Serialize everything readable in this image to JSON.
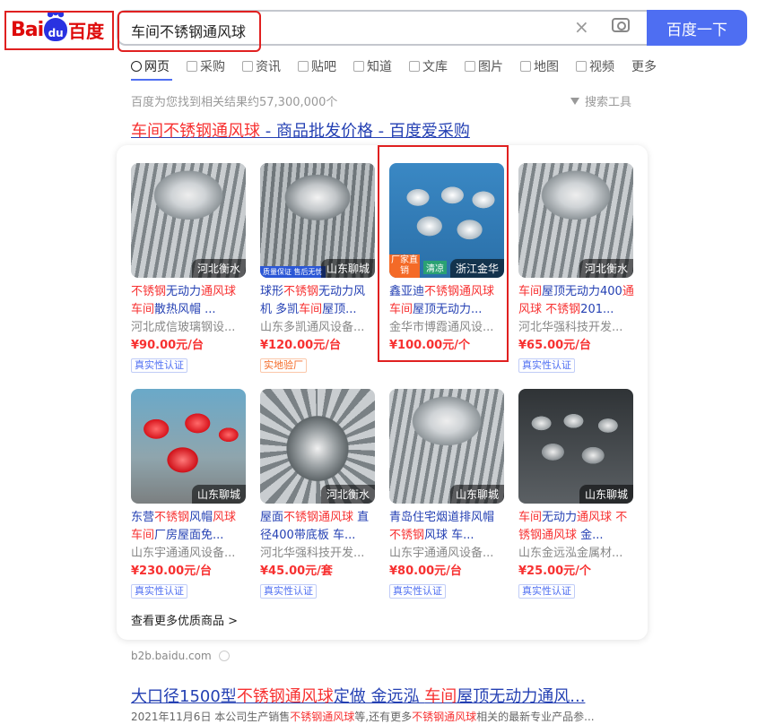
{
  "header": {
    "logo_left": "Bai",
    "logo_paw": "du",
    "logo_right": "百度",
    "query": "车间不锈钢通风球",
    "clear_icon": "×",
    "search_button": "百度一下"
  },
  "tabs": [
    {
      "label": "网页",
      "icon": "search-icon"
    },
    {
      "label": "采购",
      "icon": "shop-icon"
    },
    {
      "label": "资讯",
      "icon": "news-icon"
    },
    {
      "label": "贴吧",
      "icon": "tieba-icon"
    },
    {
      "label": "知道",
      "icon": "question-icon"
    },
    {
      "label": "文库",
      "icon": "document-icon"
    },
    {
      "label": "图片",
      "icon": "image-icon"
    },
    {
      "label": "地图",
      "icon": "map-icon"
    },
    {
      "label": "视频",
      "icon": "video-icon"
    },
    {
      "label": "更多",
      "icon": ""
    }
  ],
  "result_count": "百度为您找到相关结果约57,300,000个",
  "search_tools": "搜索工具",
  "result1": {
    "title_hl": "车间不锈钢通风球",
    "title_rest": " - 商品批发价格 - 百度爱采购",
    "more_link": "查看更多优质商品 >",
    "domain": "b2b.baidu.com"
  },
  "products": [
    {
      "loc": "河北衡水",
      "title_html": "<span class='hl'>不锈钢</span>无动力<span class='hl'>通风球</span> <span class='hl'>车间</span>散热风帽 ...",
      "seller": "河北成信玻璃钢设...",
      "price": "¥90.00元/台",
      "tag": "真实性认证"
    },
    {
      "loc": "山东聊城",
      "title_html": "球形<span class='hl'>不锈钢</span>无动力风机 多凯<span class='hl'>车间</span>屋顶...",
      "seller": "山东多凯通风设备...",
      "price": "¥120.00元/台",
      "tag": "实地验厂",
      "badge_bl": "质量保证 售后无忧"
    },
    {
      "loc": "浙江金华",
      "title_html": "鑫亚迪<span class='hl'>不锈钢通风球</span> <span class='hl'>车间</span>屋顶无动力...",
      "seller": "金华市博霞通风设...",
      "price": "¥100.00元/个",
      "tag": "",
      "badge_tl": "厂家直销",
      "badge_mid": "清凉"
    },
    {
      "loc": "河北衡水",
      "title_html": "<span class='hl'>车间</span>屋顶无动力400<span class='hl'>通风球</span> <span class='hl'>不锈钢</span>201...",
      "seller": "河北华强科技开发...",
      "price": "¥65.00元/台",
      "tag": "真实性认证"
    },
    {
      "loc": "山东聊城",
      "title_html": "东营<span class='hl'>不锈钢</span>风帽<span class='hl'>风球</span> <span class='hl'>车间</span>厂房屋面免...",
      "seller": "山东宇通通风设备...",
      "price": "¥230.00元/台",
      "tag": "真实性认证"
    },
    {
      "loc": "河北衡水",
      "title_html": "屋面<span class='hl'>不锈钢通风球</span> 直径400带底板 车...",
      "seller": "河北华强科技开发...",
      "price": "¥45.00元/套",
      "tag": "真实性认证"
    },
    {
      "loc": "山东聊城",
      "title_html": "青岛住宅烟道排风帽 <span class='hl'>不锈钢</span>风球 车...",
      "seller": "山东宇通通风设备...",
      "price": "¥80.00元/台",
      "tag": "真实性认证"
    },
    {
      "loc": "山东聊城",
      "title_html": "<span class='hl'>车间</span>无动力<span class='hl'>通风球</span> <span class='hl'>不锈钢通风球</span> 金...",
      "seller": "山东金远泓金属材...",
      "price": "¥25.00元/个",
      "tag": "真实性认证"
    }
  ],
  "result2": {
    "title_html": "大口径1500型<span class='hl'>不锈钢通风球</span>定做 金远泓 <span class='hl'>车间</span>屋顶无动力通风...",
    "snippet_html": "2021年11月6日 本公司生产销售<span class='hl'>不锈钢通风球</span>等,还有更多<span class='hl'>不锈钢通风球</span>相关的最新专业产品参..."
  },
  "colors": {
    "accent": "#4e6ef2",
    "link": "#2440b3",
    "highlight": "#f73131",
    "annotation": "#e02020"
  }
}
